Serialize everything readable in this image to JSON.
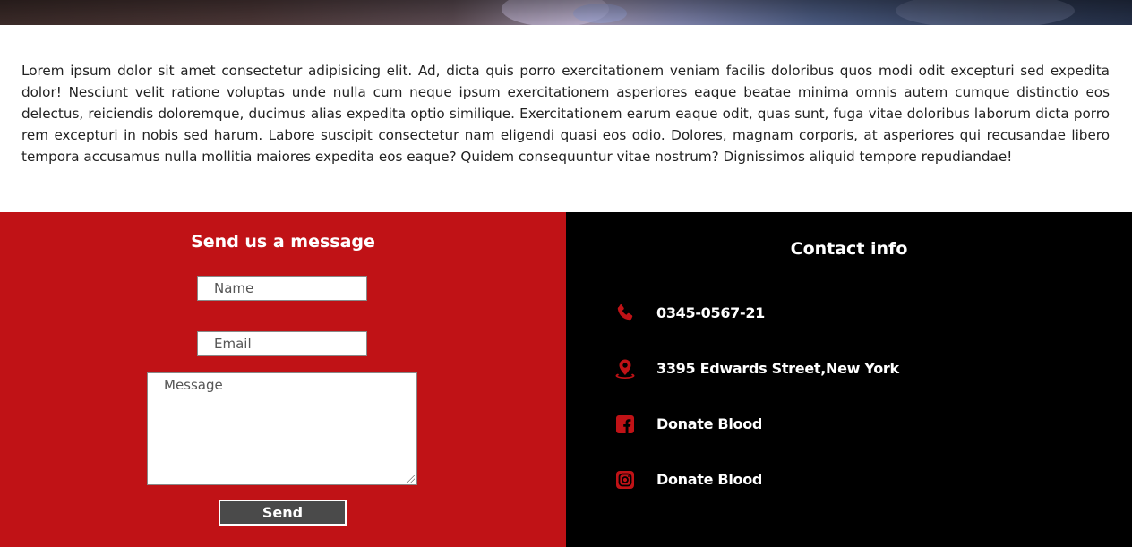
{
  "about": {
    "text": "Lorem ipsum dolor sit amet consectetur adipisicing elit. Ad, dicta quis porro exercitationem veniam facilis doloribus quos modi odit excepturi sed expedita dolor! Nesciunt velit ratione voluptas unde nulla cum neque ipsum exercitationem asperiores eaque beatae minima omnis autem cumque distinctio eos delectus, reiciendis doloremque, ducimus alias expedita optio similique. Exercitationem earum eaque odit, quas sunt, fuga vitae doloribus laborum dicta porro rem excepturi in nobis sed harum. Labore suscipit consectetur nam eligendi quasi eos odio. Dolores, magnam corporis, at asperiores qui recusandae libero tempora accusamus nulla mollitia maiores expedita eos eaque? Quidem consequuntur vitae nostrum? Dignissimos aliquid tempore repudiandae!"
  },
  "form": {
    "title": "Send us a message",
    "name_placeholder": "Name",
    "email_placeholder": "Email",
    "message_placeholder": "Message",
    "send_label": "Send"
  },
  "contact": {
    "title": "Contact info",
    "items": [
      {
        "icon": "phone-icon",
        "label": "0345-0567-21"
      },
      {
        "icon": "location-pin-icon",
        "label": "3395 Edwards Street,New York"
      },
      {
        "icon": "facebook-icon",
        "label": "Donate Blood"
      },
      {
        "icon": "instagram-icon",
        "label": "Donate Blood"
      }
    ]
  },
  "colors": {
    "form_background": "#c01216",
    "contact_background": "#000000",
    "icon_color": "#c01216",
    "button_background": "#4a4a4a"
  }
}
